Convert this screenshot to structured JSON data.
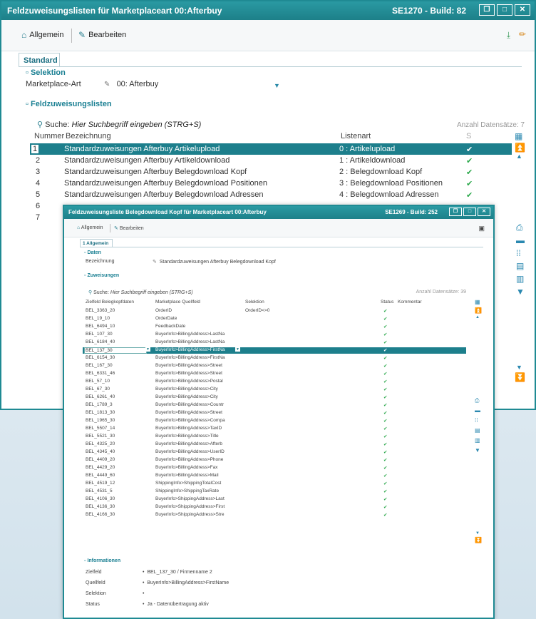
{
  "main": {
    "title": "Feldzuweisungslisten für Marketplaceart 00:Afterbuy",
    "build": "SE1270 - Build: 82",
    "toolbar": {
      "general": "Allgemein",
      "edit": "Bearbeiten"
    },
    "tab": "Standard",
    "selection_section": "Selektion",
    "marketplace_label": "Marketplace-Art",
    "marketplace_value": "00: Afterbuy",
    "list_section": "Feldzuweisungslisten",
    "search_label": "Suche:",
    "search_placeholder": "Hier Suchbegriff eingeben (STRG+S)",
    "record_count": "Anzahl Datensätze: 7",
    "columns": {
      "number": "Nummer",
      "name": "Bezeichnung",
      "type": "Listenart",
      "s": "S"
    },
    "rows": [
      {
        "num": "1",
        "name": "Standardzuweisungen Afterbuy Artikelupload",
        "type": "0 : Artikelupload"
      },
      {
        "num": "2",
        "name": "Standardzuweisungen Afterbuy Artikeldownload",
        "type": "1 : Artikeldownload"
      },
      {
        "num": "3",
        "name": "Standardzuweisungen Afterbuy Belegdownload Kopf",
        "type": "2 : Belegdownload Kopf"
      },
      {
        "num": "4",
        "name": "Standardzuweisungen Afterbuy Belegdownload Positionen",
        "type": "3 : Belegdownload Positionen"
      },
      {
        "num": "5",
        "name": "Standardzuweisungen Afterbuy Belegdownload Adressen",
        "type": "4 : Belegdownload Adressen"
      },
      {
        "num": "6",
        "name": "",
        "type": ""
      },
      {
        "num": "7",
        "name": "",
        "type": ""
      }
    ]
  },
  "detail": {
    "title": "Feldzuweisungsliste Belegdownload Kopf für Marketplaceart 00:Afterbuy",
    "build": "SE1269 - Build: 252",
    "toolbar": {
      "general": "Allgemein",
      "edit": "Bearbeiten"
    },
    "tab": "1 Allgemein",
    "data_section": "Daten",
    "name_label": "Bezeichnung",
    "name_value": "Standardzuweisungen Afterbuy Belegdownload Kopf",
    "assign_section": "Zuweisungen",
    "search_label": "Suche:",
    "search_placeholder": "Hier Suchbegriff eingeben (STRG+S)",
    "record_count": "Anzahl Datensätze: 39",
    "columns": {
      "target": "Zielfeld Belegkopfdaten",
      "source": "Marketplace Quellfeld",
      "selection": "Selektion",
      "status": "Status",
      "comment": "Kommentar"
    },
    "rows": [
      {
        "t": "BEL_3363_20",
        "s": "OrderID",
        "sel": "OrderID<>0"
      },
      {
        "t": "BEL_19_10",
        "s": "OrderDate",
        "sel": ""
      },
      {
        "t": "BEL_6494_10",
        "s": "FeedbackDate",
        "sel": ""
      },
      {
        "t": "BEL_107_30",
        "s": "BuyerInfo>BillingAddress>LastNa",
        "sel": ""
      },
      {
        "t": "BEL_6184_40",
        "s": "BuyerInfo>BillingAddress>LastNa",
        "sel": ""
      },
      {
        "t": "BEL_137_30",
        "s": "BuyerInfo>BillingAddress>FirstNa",
        "sel": ""
      },
      {
        "t": "BEL_6154_30",
        "s": "BuyerInfo>BillingAddress>FirstNa",
        "sel": ""
      },
      {
        "t": "BEL_167_30",
        "s": "BuyerInfo>BillingAddress>Street",
        "sel": ""
      },
      {
        "t": "BEL_6331_46",
        "s": "BuyerInfo>BillingAddress>Street",
        "sel": ""
      },
      {
        "t": "BEL_57_10",
        "s": "BuyerInfo>BillingAddress>Postal",
        "sel": ""
      },
      {
        "t": "BEL_67_30",
        "s": "BuyerInfo>BillingAddress>City",
        "sel": ""
      },
      {
        "t": "BEL_6261_40",
        "s": "BuyerInfo>BillingAddress>City",
        "sel": ""
      },
      {
        "t": "BEL_1789_3",
        "s": "BuyerInfo>BillingAddress>Countr",
        "sel": ""
      },
      {
        "t": "BEL_1813_30",
        "s": "BuyerInfo>BillingAddress>Street",
        "sel": ""
      },
      {
        "t": "BEL_1965_30",
        "s": "BuyerInfo>BillingAddress>Compa",
        "sel": ""
      },
      {
        "t": "BEL_5507_14",
        "s": "BuyerInfo>BillingAddress>TaxID",
        "sel": ""
      },
      {
        "t": "BEL_5521_30",
        "s": "BuyerInfo>BillingAddress>Title",
        "sel": ""
      },
      {
        "t": "BEL_4325_20",
        "s": "BuyerInfo>BillingAddress>Afterb",
        "sel": ""
      },
      {
        "t": "BEL_4345_40",
        "s": "BuyerInfo>BillingAddress>UserID",
        "sel": ""
      },
      {
        "t": "BEL_4409_20",
        "s": "BuyerInfo>BillingAddress>Phone",
        "sel": ""
      },
      {
        "t": "BEL_4429_20",
        "s": "BuyerInfo>BillingAddress>Fax",
        "sel": ""
      },
      {
        "t": "BEL_4449_60",
        "s": "BuyerInfo>BillingAddress>Mail",
        "sel": ""
      },
      {
        "t": "BEL_4519_12",
        "s": "ShippingInfo>ShippingTotalCost",
        "sel": ""
      },
      {
        "t": "BEL_4531_5",
        "s": "ShippingInfo>ShippingTaxRate",
        "sel": ""
      },
      {
        "t": "BEL_4106_30",
        "s": "BuyerInfo>ShippingAddress>Last",
        "sel": ""
      },
      {
        "t": "BEL_4136_30",
        "s": "BuyerInfo>ShippingAddress>First",
        "sel": ""
      },
      {
        "t": "BEL_4166_30",
        "s": "BuyerInfo>ShippingAddress>Stre",
        "sel": ""
      }
    ],
    "info_section": "Informationen",
    "info": [
      {
        "label": "Zielfeld",
        "value": "BEL_137_30 / Firmenname 2"
      },
      {
        "label": "Quellfeld",
        "value": "BuyerInfo>BillingAddress>FirstName"
      },
      {
        "label": "Selektion",
        "value": ""
      },
      {
        "label": "Status",
        "value": "Ja - Datenübertragung aktiv"
      }
    ]
  }
}
